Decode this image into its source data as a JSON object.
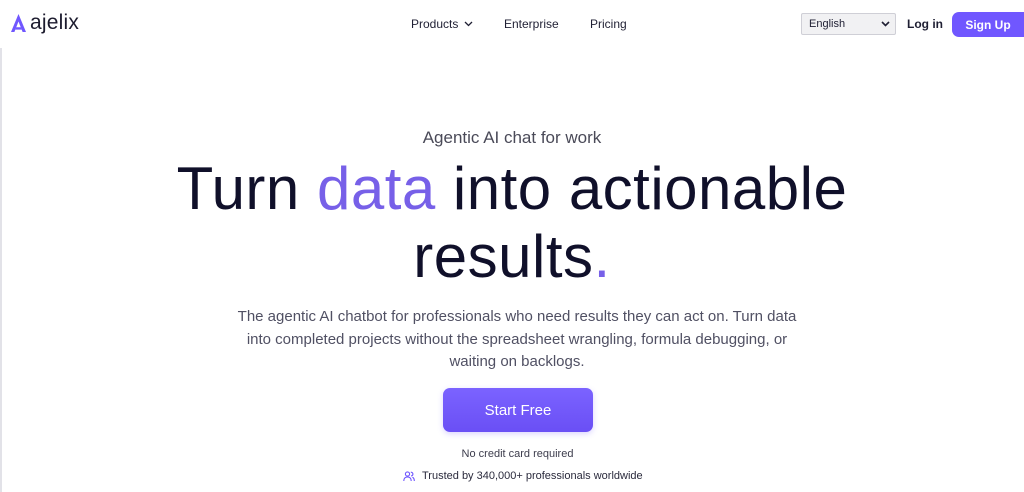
{
  "header": {
    "logo_text": "ajelix",
    "logo_icon": "ajelix-a-logo",
    "nav": {
      "products": "Products",
      "enterprise": "Enterprise",
      "pricing": "Pricing"
    },
    "language": {
      "selected": "English"
    },
    "login_label": "Log in",
    "signup_label": "Sign Up"
  },
  "hero": {
    "eyebrow": "Agentic AI chat for work",
    "headline": {
      "part1": "Turn ",
      "accent": "data",
      "part2": " into actionable",
      "line2": "results",
      "dot": "."
    },
    "subtext": "The agentic AI chatbot for professionals who need results they can act on. Turn data into completed projects without the spreadsheet wrangling, formula debugging, or waiting on backlogs.",
    "cta_label": "Start Free",
    "note": "No credit card required",
    "trusted": "Trusted by 340,000+ professionals worldwide",
    "trusted_icon": "users-icon"
  },
  "colors": {
    "accent": "#7057ff",
    "accent_text": "#7760e8",
    "headline_text": "#10102a",
    "body_text": "#505063"
  }
}
